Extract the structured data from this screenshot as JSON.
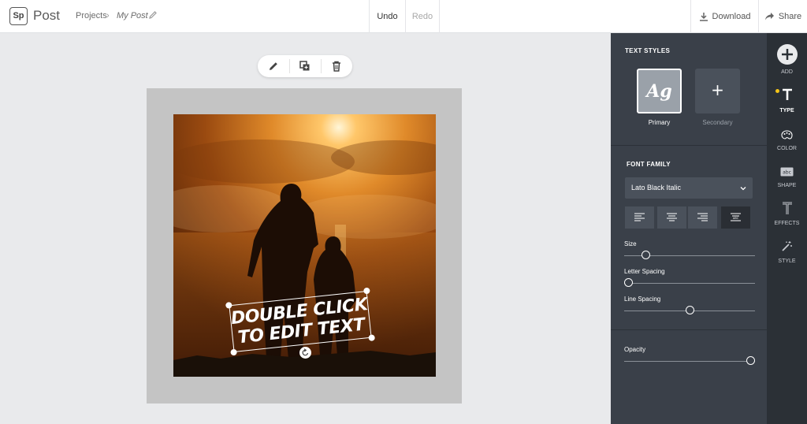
{
  "app": {
    "logo_text": "Sp",
    "name": "Post"
  },
  "breadcrumb": {
    "projects": "Projects",
    "separator": "›",
    "current": "My Post"
  },
  "toolbar": {
    "undo": "Undo",
    "redo": "Redo",
    "download": "Download",
    "share": "Share"
  },
  "floating_tools": {
    "icons": [
      "pencil-icon",
      "duplicate-icon",
      "trash-icon"
    ]
  },
  "canvas": {
    "text_line1": "DOUBLE CLICK",
    "text_line2": "TO EDIT TEXT"
  },
  "panel": {
    "text_styles_title": "TEXT STYLES",
    "primary_glyph": "Ag",
    "primary_label": "Primary",
    "secondary_glyph": "+",
    "secondary_label": "Secondary",
    "font_family_title": "FONT FAMILY",
    "font_family_value": "Lato Black Italic",
    "alignment_active": "justify",
    "size_label": "Size",
    "size_value": 0.14,
    "letter_spacing_label": "Letter Spacing",
    "letter_spacing_value": 0.0,
    "line_spacing_label": "Line Spacing",
    "line_spacing_value": 0.5,
    "opacity_label": "Opacity",
    "opacity_value": 1.0
  },
  "rail": {
    "add": "ADD",
    "type": "TYPE",
    "color": "COLOR",
    "shape": "SHAPE",
    "effects": "EFFECTS",
    "style": "STYLE",
    "active": "TYPE"
  },
  "colors": {
    "panel_bg": "#3a4049",
    "rail_bg": "#2b3036",
    "active_indicator": "#f5c518",
    "workspace_bg": "#e9eaec",
    "artboard_bg": "#c4c4c4"
  }
}
